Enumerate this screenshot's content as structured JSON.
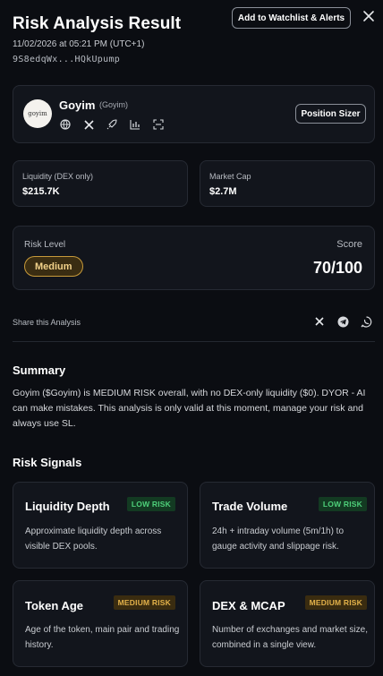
{
  "header": {
    "title": "Risk Analysis Result",
    "date": "11/02/2026 at 05:21 PM (UTC+1)",
    "address": "9S8edqWx...HQkUpump",
    "watchlist_button": "Add to Watchlist & Alerts",
    "close_icon": "close-icon"
  },
  "token": {
    "logo_text": "goyim",
    "name": "Goyim",
    "ticker": "(Goyim)",
    "icons": [
      "globe-icon",
      "x-icon",
      "rocket-icon",
      "chart-icon",
      "scan-icon"
    ],
    "position_button": "Position Sizer"
  },
  "stats": {
    "liquidity_label": "Liquidity (DEX only)",
    "liquidity_value": "$215.7K",
    "mcap_label": "Market Cap",
    "mcap_value": "$2.7M"
  },
  "risk": {
    "level_label": "Risk Level",
    "level_value": "Medium",
    "score_label": "Score",
    "score_value": "70/100"
  },
  "share": {
    "label": "Share this Analysis",
    "icons": [
      "x-icon",
      "telegram-icon",
      "whatsapp-icon"
    ]
  },
  "summary": {
    "title": "Summary",
    "text": "Goyim ($Goyim) is MEDIUM RISK overall, with no DEX-only liquidity ($0). DYOR - AI can make mistakes. This analysis is only valid at this moment, manage your risk and always use SL."
  },
  "signals": {
    "title": "Risk Signals",
    "items": [
      {
        "title": "Liquidity Depth",
        "badge": "LOW RISK",
        "desc": "Approximate liquidity depth across visible DEX pools."
      },
      {
        "title": "Trade Volume",
        "badge": "LOW RISK",
        "desc": "24h + intraday volume (5m/1h) to gauge activity and slippage risk."
      },
      {
        "title": "Token Age",
        "badge": "MEDIUM RISK",
        "desc": "Age of the token, main pair and trading history."
      },
      {
        "title": "DEX & MCAP",
        "badge": "MEDIUM RISK",
        "desc": "Number of exchanges and market size, combined in a single view."
      }
    ]
  },
  "colors": {
    "background": "#0b0d12",
    "card": "#12151c",
    "low_risk": "#4ed07a",
    "medium_risk": "#e3b24a"
  }
}
